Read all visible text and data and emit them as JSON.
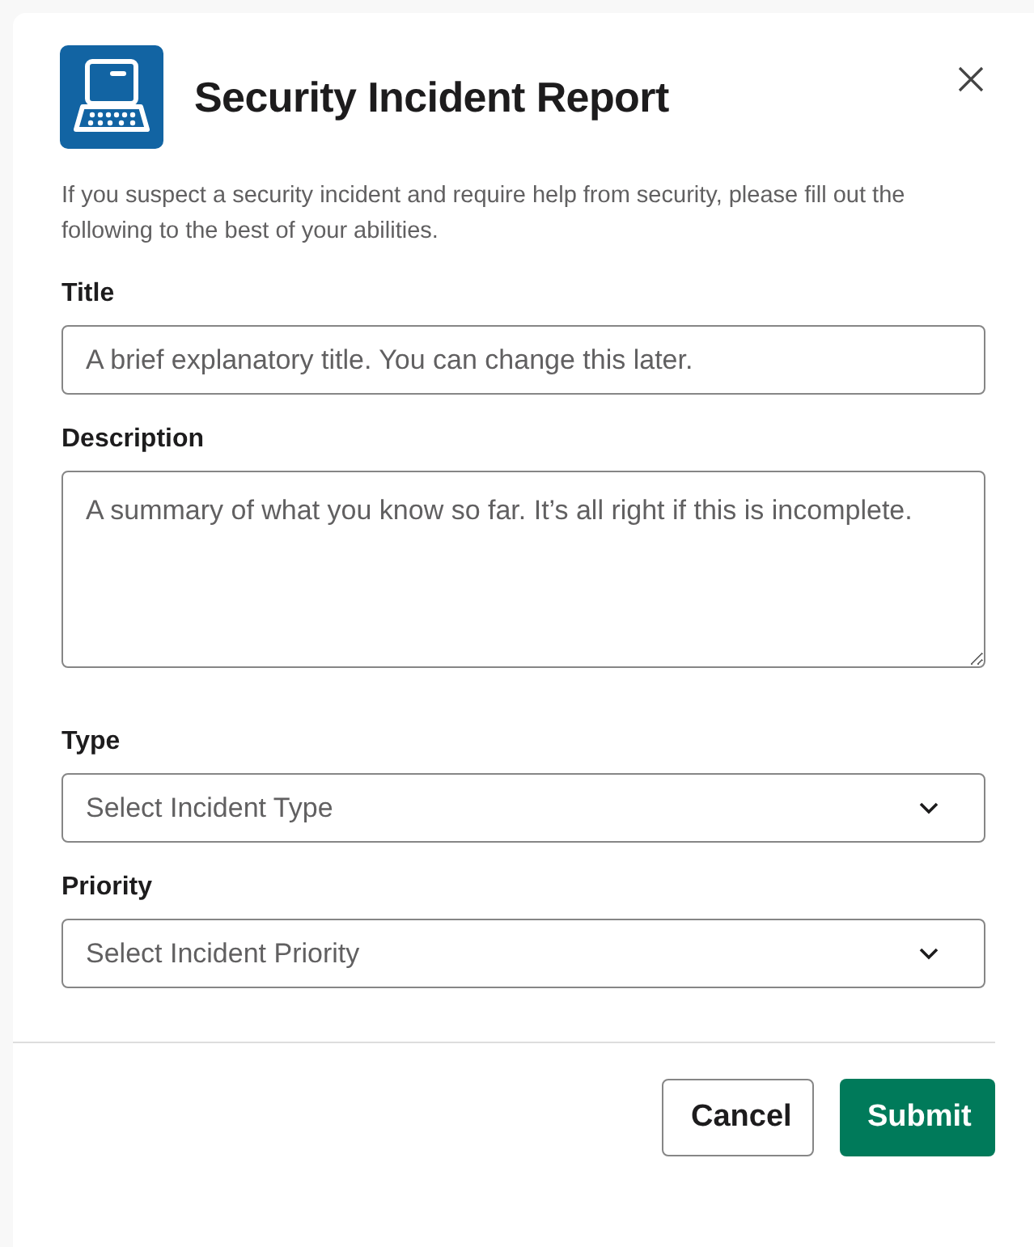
{
  "modal": {
    "title": "Security Incident Report",
    "intro": "If you suspect a security incident and require help from security, please fill out the following to the best of your abilities."
  },
  "fields": [
    {
      "kind": "text",
      "label": "Title",
      "placeholder": "A brief explanatory title. You can change this later."
    },
    {
      "kind": "textarea",
      "label": "Description",
      "placeholder": "A summary of what you know so far. It’s all right if this is incomplete."
    },
    {
      "kind": "select",
      "label": "Type",
      "placeholder": "Select Incident Type"
    },
    {
      "kind": "select",
      "label": "Priority",
      "placeholder": "Select Incident Priority"
    }
  ],
  "buttons": [
    {
      "kind": "secondary",
      "label": "Cancel"
    },
    {
      "kind": "primary",
      "label": "Submit"
    }
  ]
}
